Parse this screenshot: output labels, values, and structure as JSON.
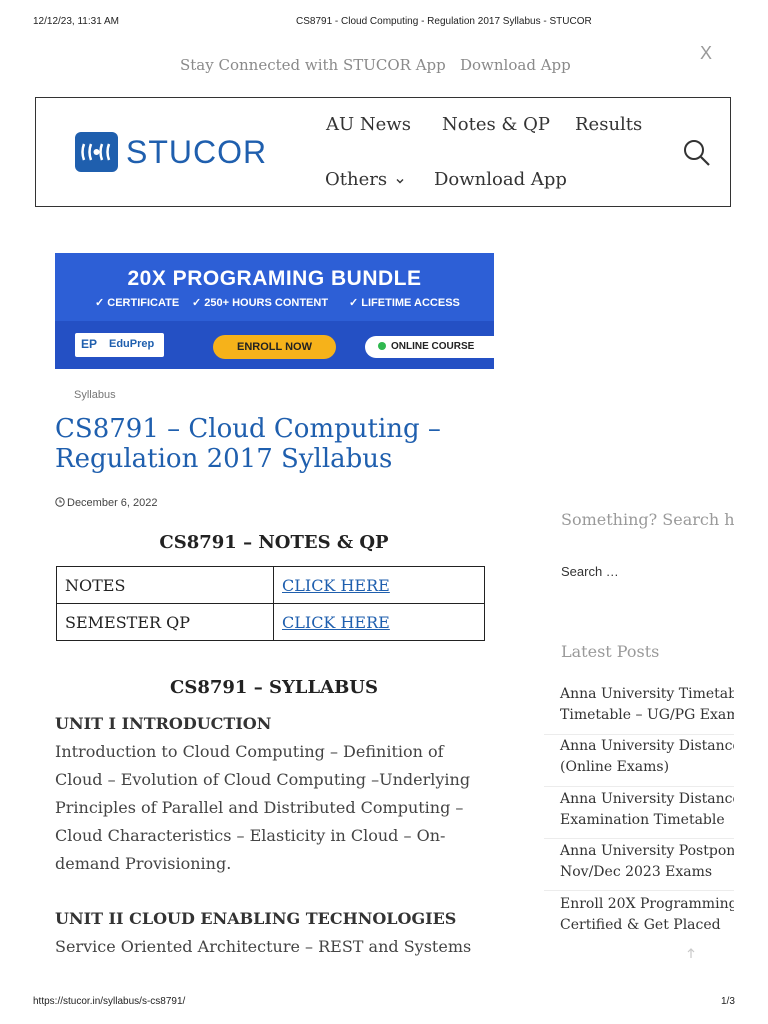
{
  "print_header": {
    "datetime": "12/12/23, 11:31 AM",
    "page_title": "CS8791 - Cloud Computing - Regulation 2017 Syllabus - STUCOR"
  },
  "topbar": {
    "text": "Stay Connected with STUCOR App",
    "download_label": "Download App",
    "close_label": "X"
  },
  "header": {
    "logo_text": "STUCOR",
    "nav": {
      "au_news": "AU News",
      "notes_qp": "Notes & QP",
      "results": "Results",
      "others": "Others",
      "download_app": "Download App"
    },
    "search_icon": "search-icon"
  },
  "banner": {
    "title": "20X PROGRAMING BUNDLE",
    "features": [
      "✓ CERTIFICATE",
      "✓ 250+ HOURS CONTENT",
      "✓ LIFETIME ACCESS"
    ],
    "brand": "EduPrep",
    "brand_mark": "EP",
    "enroll": "ENROLL NOW",
    "online": "ONLINE COURSE",
    "colors": {
      "background": "#2d5fd6",
      "button": "#f6b21a"
    }
  },
  "post": {
    "category": "Syllabus",
    "title": "CS8791 – Cloud Computing – Regulation 2017 Syllabus",
    "date": "December 6, 2022",
    "notes_heading": "CS8791 – NOTES & QP",
    "notes_table": [
      {
        "label": "NOTES",
        "link": "CLICK HERE"
      },
      {
        "label": "SEMESTER QP",
        "link": "CLICK HERE"
      }
    ],
    "syllabus_heading": "CS8791 – SYLLABUS",
    "unit1_heading": "UNIT I INTRODUCTION",
    "unit1_lines": [
      "Introduction to Cloud Computing – Definition of",
      "Cloud – Evolution of Cloud Computing –Underlying",
      "Principles of Parallel and Distributed Computing –",
      "Cloud Characteristics – Elasticity in Cloud – On-",
      "demand Provisioning."
    ],
    "unit2_heading": "UNIT II CLOUD ENABLING TECHNOLOGIES",
    "unit2_line": "Service Oriented Architecture – REST and Systems"
  },
  "sidebar": {
    "search_prompt": "Something? Search h",
    "search_placeholder": "Search …",
    "latest_heading": "Latest Posts",
    "latest_posts": [
      [
        "Anna University Timetab",
        "Timetable – UG/PG Exam"
      ],
      [
        "Anna University Distance",
        "(Online Exams)"
      ],
      [
        "Anna University Distance",
        "Examination Timetable"
      ],
      [
        "Anna University Postpon",
        "Nov/Dec 2023 Exams"
      ],
      [
        "Enroll 20X Programming",
        "Certified & Get Placed"
      ]
    ]
  },
  "print_footer": {
    "url": "https://stucor.in/syllabus/s-cs8791/",
    "page": "1/3"
  },
  "colors": {
    "brand": "#1f5fae",
    "muted": "#9a9a9a"
  }
}
